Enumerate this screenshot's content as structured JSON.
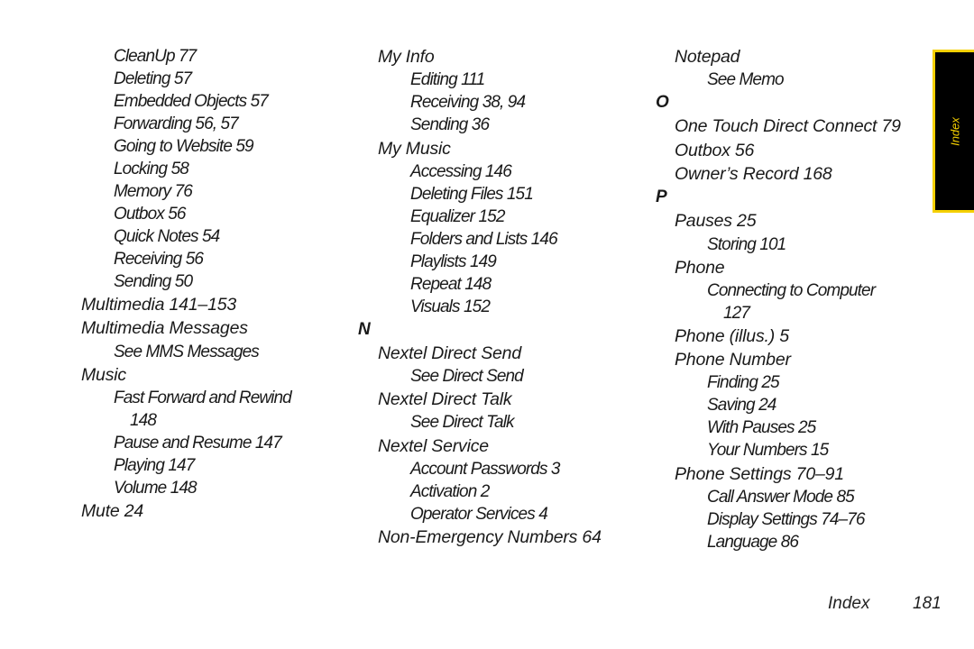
{
  "columns": [
    {
      "lines": [
        {
          "text": "CleanUp 77",
          "level": 2
        },
        {
          "text": "Deleting 57",
          "level": 2
        },
        {
          "text": "Embedded Objects 57",
          "level": 2
        },
        {
          "text": "Forwarding 56, 57",
          "level": 2
        },
        {
          "text": "Going to Website 59",
          "level": 2
        },
        {
          "text": "Locking 58",
          "level": 2
        },
        {
          "text": "Memory 76",
          "level": 2
        },
        {
          "text": "Outbox 56",
          "level": 2
        },
        {
          "text": "Quick Notes 54",
          "level": 2
        },
        {
          "text": "Receiving 56",
          "level": 2
        },
        {
          "text": "Sending 50",
          "level": 2
        },
        {
          "text": "Multimedia 141–153",
          "level": 1
        },
        {
          "text": "Multimedia Messages",
          "level": 1
        },
        {
          "text": "See MMS Messages",
          "level": 2
        },
        {
          "text": "Music",
          "level": 1
        },
        {
          "text": "Fast Forward and Rewind",
          "level": 2
        },
        {
          "text": "148",
          "level": 3
        },
        {
          "text": "Pause and Resume 147",
          "level": 2
        },
        {
          "text": "Playing 147",
          "level": 2
        },
        {
          "text": "Volume 148",
          "level": 2
        },
        {
          "text": "Mute 24",
          "level": 1
        }
      ]
    },
    {
      "lines": [
        {
          "text": "My Info",
          "level": 1
        },
        {
          "text": "Editing 111",
          "level": 2
        },
        {
          "text": "Receiving 38, 94",
          "level": 2
        },
        {
          "text": "Sending 36",
          "level": 2
        },
        {
          "text": "My Music",
          "level": 1
        },
        {
          "text": "Accessing 146",
          "level": 2
        },
        {
          "text": "Deleting Files 151",
          "level": 2
        },
        {
          "text": "Equalizer 152",
          "level": 2
        },
        {
          "text": "Folders and Lists 146",
          "level": 2
        },
        {
          "text": "Playlists 149",
          "level": 2
        },
        {
          "text": "Repeat 148",
          "level": 2
        },
        {
          "text": "Visuals 152",
          "level": 2
        },
        {
          "text": "N",
          "level": 0
        },
        {
          "text": "Nextel Direct Send",
          "level": 1
        },
        {
          "text": "See Direct Send",
          "level": 2
        },
        {
          "text": "Nextel Direct Talk",
          "level": 1
        },
        {
          "text": "See Direct Talk",
          "level": 2
        },
        {
          "text": "Nextel Service",
          "level": 1
        },
        {
          "text": "Account Passwords 3",
          "level": 2
        },
        {
          "text": "Activation 2",
          "level": 2
        },
        {
          "text": "Operator Services 4",
          "level": 2
        },
        {
          "text": "Non-Emergency Numbers 64",
          "level": 1
        }
      ]
    },
    {
      "lines": [
        {
          "text": "Notepad",
          "level": 1
        },
        {
          "text": "See Memo",
          "level": 2
        },
        {
          "text": "O",
          "level": 0
        },
        {
          "text": "One Touch Direct Connect 79",
          "level": 1
        },
        {
          "text": "Outbox 56",
          "level": 1
        },
        {
          "text": "Owner’s Record 168",
          "level": 1
        },
        {
          "text": "P",
          "level": 0
        },
        {
          "text": "Pauses 25",
          "level": 1
        },
        {
          "text": "Storing 101",
          "level": 2
        },
        {
          "text": "Phone",
          "level": 1
        },
        {
          "text": "Connecting to Computer",
          "level": 2
        },
        {
          "text": "127",
          "level": 3
        },
        {
          "text": "Phone (illus.) 5",
          "level": 1
        },
        {
          "text": "Phone Number",
          "level": 1
        },
        {
          "text": "Finding 25",
          "level": 2
        },
        {
          "text": "Saving 24",
          "level": 2
        },
        {
          "text": "With Pauses 25",
          "level": 2
        },
        {
          "text": "Your Numbers 15",
          "level": 2
        },
        {
          "text": "Phone Settings 70–91",
          "level": 1
        },
        {
          "text": "Call Answer Mode 85",
          "level": 2
        },
        {
          "text": "Display Settings 74–76",
          "level": 2
        },
        {
          "text": "Language 86",
          "level": 2
        }
      ]
    }
  ],
  "side_tab": {
    "label": "Index",
    "colors": {
      "background": "#000000",
      "accent": "#f5d000"
    }
  },
  "footer": {
    "section": "Index",
    "page_number": "181"
  }
}
